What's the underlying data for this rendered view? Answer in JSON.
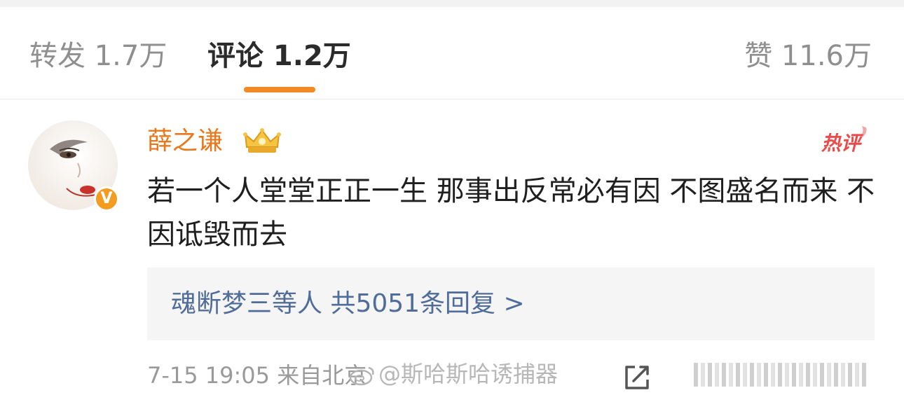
{
  "tabs": {
    "repost": "转发 1.7万",
    "comment": "评论 1.2万",
    "like": "赞 11.6万"
  },
  "comment": {
    "username": "薛之谦",
    "hot_label": "热评",
    "verified_badge": "V",
    "text": "若一个人堂堂正正一生 那事出反常必有因 不图盛名而来 不因诋毁而去",
    "replies": "魂断梦三等人  共5051条回复 >",
    "meta": "7-15 19:05  来自北京",
    "watermark": "@斯哈斯哈诱捕器"
  },
  "colors": {
    "accent": "#f08a22",
    "username": "#e8781c",
    "reply_link": "#506c98",
    "hot": "#e94b4b"
  },
  "icons": [
    "crown-icon",
    "hot-comment-badge",
    "share-icon",
    "weibo-logo-icon"
  ]
}
